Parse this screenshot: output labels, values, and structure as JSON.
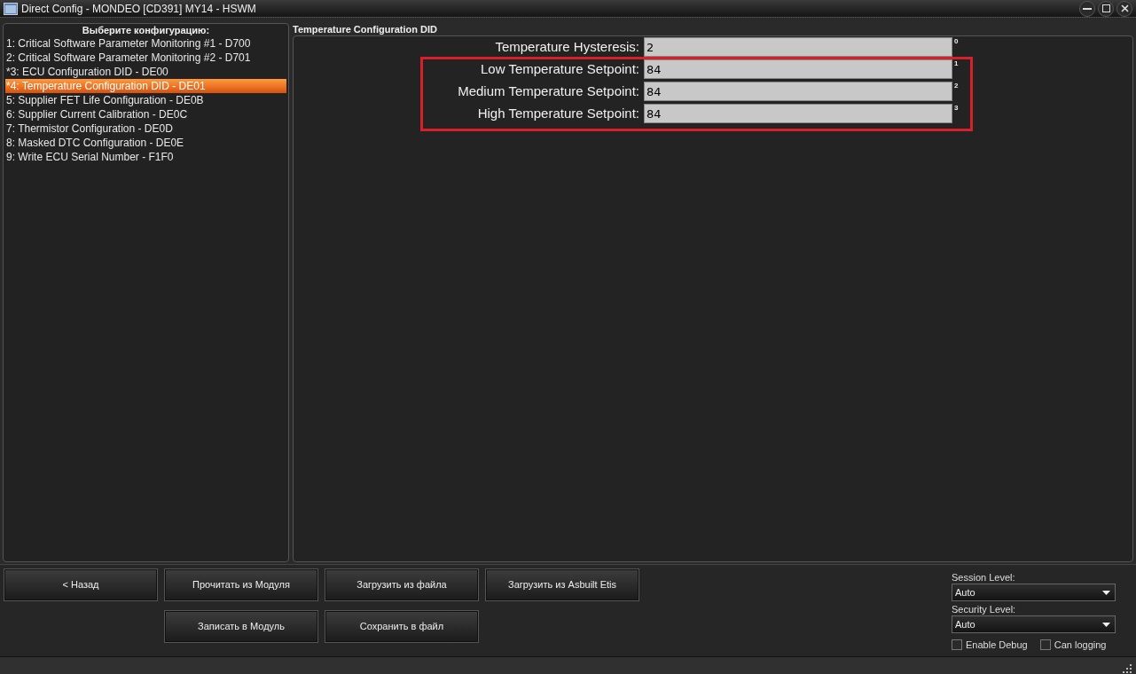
{
  "window": {
    "title": "Direct Config - MONDEO [CD391] MY14 - HSWM"
  },
  "sidebar": {
    "heading": "Выберите конфигурацию:",
    "items": [
      {
        "label": "1: Critical Software Parameter Monitoring #1 - D700",
        "selected": false
      },
      {
        "label": "2: Critical Software Parameter Monitoring #2 - D701",
        "selected": false
      },
      {
        "label": "*3: ECU Configuration DID - DE00",
        "selected": false
      },
      {
        "label": "*4: Temperature Configuration DID - DE01",
        "selected": true
      },
      {
        "label": "5: Supplier FET Life Configuration - DE0B",
        "selected": false
      },
      {
        "label": "6: Supplier Current Calibration - DE0C",
        "selected": false
      },
      {
        "label": "7: Thermistor Configuration - DE0D",
        "selected": false
      },
      {
        "label": "8: Masked DTC Configuration - DE0E",
        "selected": false
      },
      {
        "label": "9: Write ECU Serial Number - F1F0",
        "selected": false
      }
    ]
  },
  "panel": {
    "title": "Temperature Configuration DID",
    "fields": [
      {
        "label": "Temperature Hysteresis:",
        "value": "2",
        "index": "0"
      }
    ],
    "highlighted_fields": [
      {
        "label": "Low Temperature Setpoint:",
        "value": "84",
        "index": "1"
      },
      {
        "label": "Medium Temperature Setpoint:",
        "value": "84",
        "index": "2"
      },
      {
        "label": "High Temperature Setpoint:",
        "value": "84",
        "index": "3"
      }
    ]
  },
  "button_rows": [
    [
      "< Назад",
      "Прочитать из Модуля",
      "Загрузить из файла",
      "Загрузить из Asbuilt Etis"
    ],
    [
      "Записать в Модуль",
      "Сохранить в файл"
    ]
  ],
  "settings": {
    "selects": [
      {
        "label": "Session Level:",
        "value": "Auto"
      },
      {
        "label": "Security Level:",
        "value": "Auto"
      }
    ],
    "checkboxes": [
      {
        "label": "Enable Debug",
        "checked": false
      },
      {
        "label": "Can logging",
        "checked": false
      }
    ]
  }
}
